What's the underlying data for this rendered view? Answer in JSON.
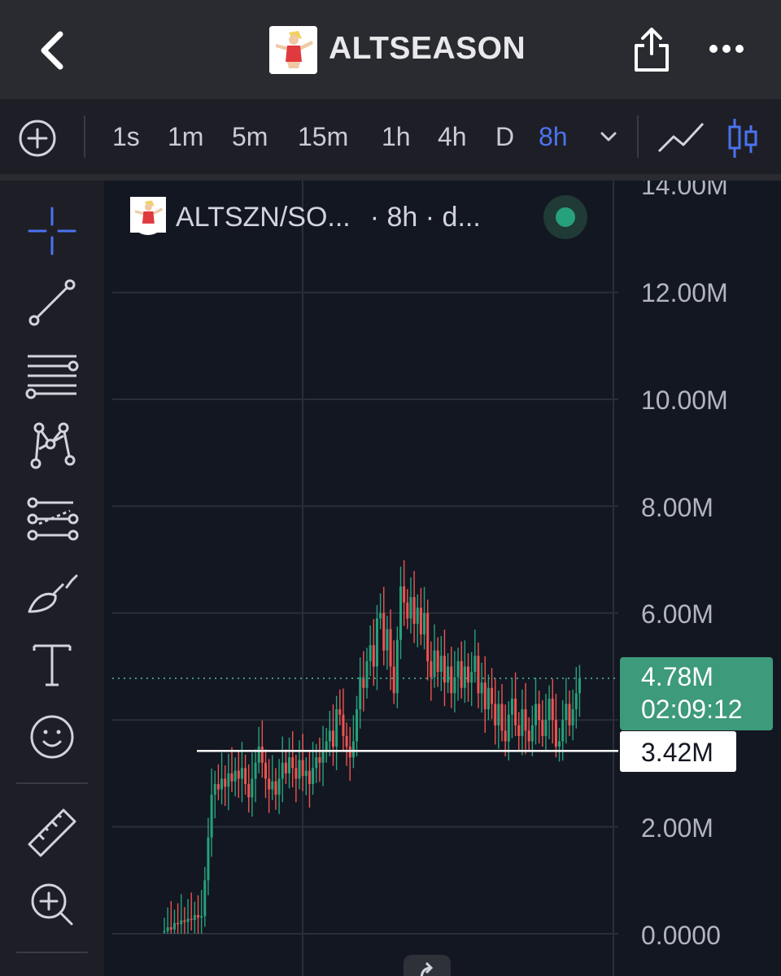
{
  "header": {
    "title": "ALTSEASON",
    "back_icon": "chevron-left-icon",
    "share_icon": "share-icon",
    "more_icon": "more-horizontal-icon"
  },
  "toolbar": {
    "intervals": [
      "1s",
      "1m",
      "5m",
      "15m",
      "1h",
      "4h",
      "D",
      "8h"
    ],
    "active_interval": "8h",
    "accent_color": "#4b73f0"
  },
  "sidebar_tools": [
    "crosshair-icon",
    "trend-line-icon",
    "horizontal-lines-icon",
    "pattern-icon",
    "fib-icon",
    "brush-icon",
    "text-icon",
    "emoji-icon",
    "ruler-icon",
    "zoom-in-icon"
  ],
  "legend": {
    "symbol": "ALTSZN/SO...",
    "meta": "· 8h · d...",
    "status_color": "#26a17b"
  },
  "price_axis": {
    "labels": [
      "14.00M",
      "12.00M",
      "10.00M",
      "8.00M",
      "6.00M",
      "2.00M",
      "0.0000"
    ],
    "current_price": "4.78M",
    "countdown": "02:09:12",
    "horizontal_line_price": "3.42M"
  },
  "chart_data": {
    "type": "candlestick",
    "ylim": [
      0,
      14000000
    ],
    "up_color": "#26a17b",
    "down_color": "#ef5350",
    "current_price": 4780000,
    "horizontal_line": 3420000,
    "closes": [
      0.05,
      0.12,
      0.08,
      0.2,
      0.18,
      0.25,
      0.22,
      0.28,
      0.26,
      0.35,
      0.3,
      0.33,
      1.0,
      1.8,
      2.6,
      2.8,
      2.7,
      2.9,
      2.75,
      3.0,
      2.85,
      3.05,
      2.9,
      3.1,
      2.8,
      2.55,
      2.9,
      3.2,
      3.5,
      3.2,
      2.9,
      2.7,
      2.85,
      2.6,
      2.9,
      3.2,
      3.0,
      3.3,
      3.1,
      2.9,
      3.25,
      2.95,
      3.05,
      2.8,
      3.1,
      3.3,
      3.2,
      3.4,
      3.6,
      3.8,
      3.5,
      4.2,
      4.1,
      3.7,
      3.5,
      3.3,
      3.6,
      4.2,
      4.8,
      4.6,
      5.1,
      5.4,
      5.0,
      5.9,
      6.0,
      5.3,
      5.7,
      5.0,
      4.5,
      5.5,
      6.5,
      6.2,
      5.9,
      6.3,
      5.8,
      6.1,
      5.6,
      6.0,
      5.1,
      4.8,
      5.3,
      4.9,
      5.2,
      4.7,
      5.0,
      4.5,
      4.8,
      5.1,
      4.6,
      5.0,
      4.7,
      4.9,
      5.2,
      4.5,
      4.7,
      4.2,
      4.6,
      4.3,
      3.9,
      4.3,
      3.8,
      3.6,
      4.1,
      4.4,
      3.9,
      3.7,
      4.2,
      3.8,
      3.6,
      3.9,
      4.3,
      4.0,
      3.7,
      4.0,
      4.4,
      4.0,
      3.5,
      3.6,
      4.0,
      4.3,
      3.9,
      4.2,
      4.5,
      4.78
    ]
  }
}
